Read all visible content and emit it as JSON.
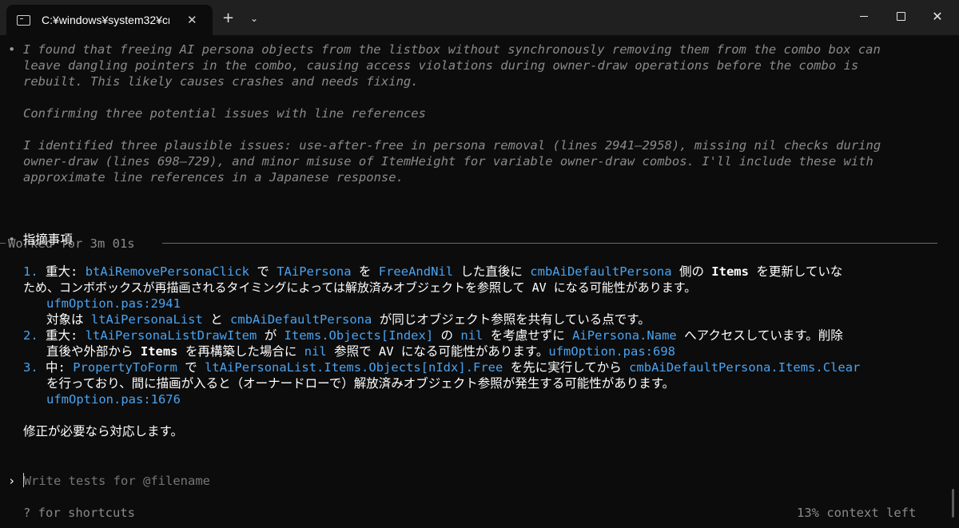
{
  "window": {
    "tab_title": "C:¥windows¥system32¥cn",
    "tab_close": "✕",
    "new_tab": "+",
    "dropdown": "⌄",
    "minimize": "",
    "maximize": "",
    "close": "✕"
  },
  "thinking": {
    "bullet": "•",
    "para1": [
      "I found that freeing AI persona objects from the listbox without synchronously removing them from the combo box can",
      "leave dangling pointers in the combo, causing access violations during owner-draw operations before the combo is",
      "rebuilt. This likely causes crashes and needs fixing."
    ],
    "heading": "Confirming three potential issues with line references",
    "para2": [
      "I identified three plausible issues: use-after-free in persona removal (lines 2941–2958), missing nil checks during",
      "owner-draw (lines 698–729), and minor misuse of ItemHeight for variable owner-draw combos. I'll include these with",
      "approximate line references in a Japanese response."
    ]
  },
  "separator": {
    "text": "Worked for 3m 01s"
  },
  "answer": {
    "bullet": "•",
    "title": "指摘事項",
    "item1": {
      "num": "1.",
      "l1_a": "重大:",
      "l1_code1": "btAiRemovePersonaClick",
      "l1_b": "で",
      "l1_code2": "TAiPersona",
      "l1_c": "を",
      "l1_code3": "FreeAndNil",
      "l1_d": "した直後に",
      "l1_code4": "cmbAiDefaultPersona",
      "l1_e": "側の",
      "l1_bold": "Items",
      "l1_f": "を更新していな",
      "l2": "ため、コンボボックスが再描画されるタイミングによっては解放済みオブジェクトを参照して AV になる可能性があります。",
      "l3_code": "ufmOption.pas:2941",
      "l4_a": "対象は",
      "l4_code1": "ltAiPersonaList",
      "l4_b": "と",
      "l4_code2": "cmbAiDefaultPersona",
      "l4_c": "が同じオブジェクト参照を共有している点です。"
    },
    "item2": {
      "num": "2.",
      "l1_a": "重大:",
      "l1_code1": "ltAiPersonaListDrawItem",
      "l1_b": "が",
      "l1_code2": "Items.Objects[Index]",
      "l1_c": "の",
      "l1_code3": "nil",
      "l1_d": "を考慮せずに",
      "l1_code4": "AiPersona.Name",
      "l1_e": "へアクセスしています。削除",
      "l2_a": "直後や外部から",
      "l2_bold": "Items",
      "l2_b": "を再構築した場合に",
      "l2_code1": "nil",
      "l2_c": "参照で AV になる可能性があります。",
      "l2_code2": "ufmOption.pas:698"
    },
    "item3": {
      "num": "3.",
      "l1_a": "中:",
      "l1_code1": "PropertyToForm",
      "l1_b": "で",
      "l1_code2": "ltAiPersonaList.Items.Objects[nIdx].Free",
      "l1_c": "を先に実行してから",
      "l1_code3": "cmbAiDefaultPersona.Items.Clear",
      "l2": "を行っており、間に描画が入ると（オーナードローで）解放済みオブジェクト参照が発生する可能性があります。",
      "l3_code": "ufmOption.pas:1676"
    },
    "closing": "修正が必要なら対応します。"
  },
  "input": {
    "arrow": "›",
    "placeholder": "Write tests for @filename"
  },
  "footer": {
    "shortcuts": "? for shortcuts",
    "context": "13% context left"
  }
}
